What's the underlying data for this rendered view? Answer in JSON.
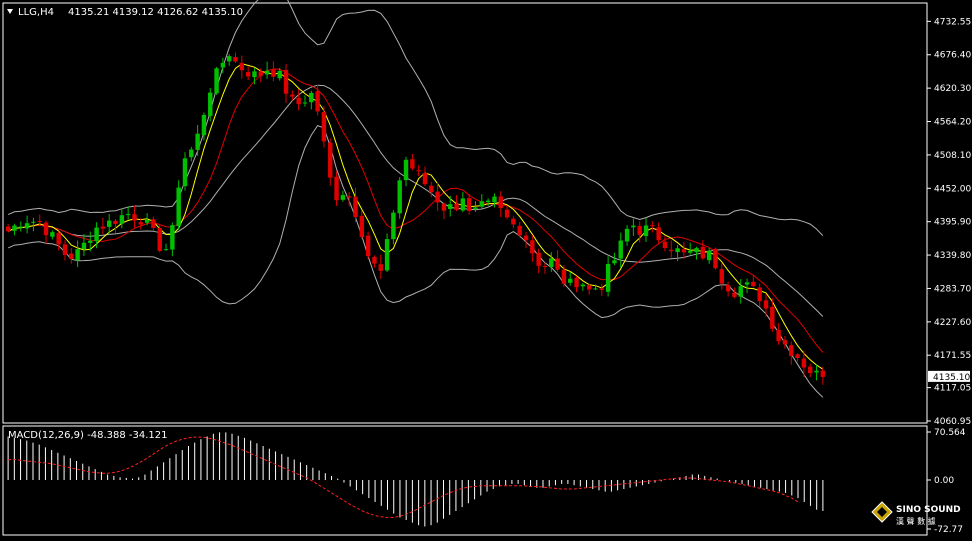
{
  "header": {
    "symbol": "LLG,H4",
    "ohlc": "4135.21 4139.12 4126.62 4135.10"
  },
  "price_axis": {
    "ticks": [
      "4732.55",
      "4676.40",
      "4620.30",
      "4564.20",
      "4508.10",
      "4452.00",
      "4395.90",
      "4339.80",
      "4283.70",
      "4227.60",
      "4171.55",
      "4117.05",
      "4060.95"
    ],
    "current_price_label": "4135.10"
  },
  "macd_panel": {
    "label": "MACD(12,26,9) -48.388 -34.121",
    "ticks": [
      "70.564",
      "0.00",
      "-72.77"
    ]
  },
  "logo": {
    "name": "SINO SOUND",
    "chinese": "漢 聲 數 據"
  },
  "colors": {
    "background": "#000000",
    "bull": "#00c000",
    "bear": "#e00000",
    "bands": "#b0b0b0",
    "ma_fast": "#ffff00",
    "ma_slow": "#e00000",
    "macd_hist": "#ffffff",
    "macd_signal": "#ff2020",
    "grid_border": "#ffffff"
  },
  "chart_data": [
    {
      "type": "candlestick",
      "title": "LLG,H4",
      "ylim": [
        4060.95,
        4760
      ],
      "y_ticks": [
        4732.55,
        4676.4,
        4620.3,
        4564.2,
        4508.1,
        4452.0,
        4395.9,
        4339.8,
        4283.7,
        4227.6,
        4171.55,
        4117.05,
        4060.95
      ],
      "indicators": [
        "bollinger_bands",
        "moving_average_fast",
        "moving_average_slow"
      ],
      "path_points": [
        [
          0,
          4380
        ],
        [
          10,
          4400
        ],
        [
          20,
          4395
        ],
        [
          28,
          4370
        ],
        [
          38,
          4335
        ],
        [
          45,
          4345
        ],
        [
          55,
          4385
        ],
        [
          65,
          4395
        ],
        [
          75,
          4410
        ],
        [
          85,
          4400
        ],
        [
          92,
          4375
        ],
        [
          98,
          4345
        ],
        [
          103,
          4360
        ],
        [
          106,
          4420
        ],
        [
          110,
          4500
        ],
        [
          115,
          4510
        ],
        [
          120,
          4540
        ],
        [
          128,
          4620
        ],
        [
          135,
          4660
        ],
        [
          140,
          4680
        ],
        [
          145,
          4660
        ],
        [
          150,
          4650
        ],
        [
          158,
          4640
        ],
        [
          165,
          4655
        ],
        [
          172,
          4640
        ],
        [
          178,
          4605
        ],
        [
          182,
          4590
        ],
        [
          187,
          4600
        ],
        [
          192,
          4610
        ],
        [
          198,
          4570
        ],
        [
          202,
          4480
        ],
        [
          208,
          4440
        ],
        [
          214,
          4450
        ],
        [
          222,
          4400
        ],
        [
          229,
          4330
        ],
        [
          236,
          4310
        ],
        [
          242,
          4380
        ],
        [
          246,
          4450
        ],
        [
          252,
          4500
        ],
        [
          258,
          4480
        ],
        [
          264,
          4460
        ],
        [
          270,
          4440
        ],
        [
          276,
          4420
        ],
        [
          283,
          4420
        ],
        [
          288,
          4440
        ],
        [
          293,
          4400
        ],
        [
          298,
          4420
        ],
        [
          303,
          4420
        ],
        [
          308,
          4430
        ],
        [
          314,
          4405
        ],
        [
          320,
          4390
        ],
        [
          326,
          4380
        ],
        [
          333,
          4340
        ],
        [
          338,
          4320
        ],
        [
          344,
          4330
        ],
        [
          350,
          4300
        ],
        [
          356,
          4290
        ],
        [
          362,
          4300
        ],
        [
          368,
          4280
        ],
        [
          372,
          4285
        ],
        [
          376,
          4290
        ],
        [
          381,
          4320
        ],
        [
          386,
          4340
        ],
        [
          391,
          4380
        ],
        [
          396,
          4390
        ],
        [
          401,
          4380
        ],
        [
          406,
          4385
        ],
        [
          412,
          4370
        ],
        [
          417,
          4360
        ],
        [
          422,
          4350
        ],
        [
          428,
          4340
        ],
        [
          434,
          4345
        ],
        [
          440,
          4340
        ],
        [
          446,
          4340
        ],
        [
          450,
          4310
        ],
        [
          455,
          4290
        ],
        [
          460,
          4280
        ],
        [
          466,
          4290
        ],
        [
          472,
          4280
        ],
        [
          476,
          4270
        ],
        [
          481,
          4245
        ],
        [
          488,
          4200
        ],
        [
          494,
          4185
        ],
        [
          500,
          4170
        ],
        [
          506,
          4150
        ],
        [
          511,
          4140
        ],
        [
          516,
          4135
        ]
      ],
      "current_price": 4135.1
    },
    {
      "type": "bar",
      "title": "MACD(12,26,9) -48.388 -34.121",
      "ylim": [
        -72.77,
        70.564
      ],
      "macd_value": -48.388,
      "signal_value": -34.121,
      "histogram": [
        64,
        62,
        60,
        58,
        55,
        52,
        48,
        44,
        40,
        36,
        32,
        28,
        24,
        20,
        16,
        12,
        8,
        6,
        4,
        3,
        2,
        4,
        8,
        14,
        20,
        26,
        32,
        38,
        44,
        50,
        55,
        60,
        64,
        68,
        70,
        70,
        68,
        65,
        62,
        58,
        54,
        50,
        46,
        42,
        38,
        34,
        30,
        26,
        22,
        18,
        14,
        10,
        6,
        2,
        -4,
        -10,
        -16,
        -22,
        -28,
        -34,
        -40,
        -46,
        -52,
        -58,
        -62,
        -66,
        -70,
        -72,
        -70,
        -66,
        -60,
        -54,
        -48,
        -42,
        -36,
        -30,
        -24,
        -18,
        -14,
        -10,
        -8,
        -6,
        -6,
        -8,
        -10,
        -12,
        -12,
        -10,
        -8,
        -6,
        -6,
        -8,
        -10,
        -12,
        -14,
        -16,
        -18,
        -18,
        -16,
        -14,
        -12,
        -10,
        -8,
        -6,
        -4,
        -2,
        0,
        2,
        4,
        6,
        8,
        8,
        6,
        4,
        2,
        0,
        -2,
        -4,
        -6,
        -8,
        -10,
        -12,
        -14,
        -16,
        -18,
        -20,
        -24,
        -28,
        -34,
        -40,
        -46,
        -48
      ],
      "signal": [
        30,
        30,
        29,
        28,
        27,
        26,
        25,
        24,
        22,
        20,
        18,
        16,
        14,
        12,
        11,
        10,
        10,
        11,
        13,
        16,
        20,
        25,
        30,
        36,
        42,
        48,
        53,
        57,
        60,
        62,
        63,
        63,
        62,
        60,
        57,
        54,
        51,
        47,
        43,
        39,
        35,
        31,
        27,
        23,
        19,
        15,
        11,
        7,
        3,
        -2,
        -8,
        -14,
        -20,
        -26,
        -32,
        -38,
        -43,
        -48,
        -52,
        -55,
        -57,
        -58,
        -58,
        -56,
        -53,
        -49,
        -44,
        -39,
        -34,
        -29,
        -24,
        -20,
        -16,
        -13,
        -11,
        -10,
        -9,
        -9,
        -9,
        -9,
        -9,
        -9,
        -9,
        -9,
        -10,
        -10,
        -11,
        -12,
        -13,
        -14,
        -14,
        -14,
        -13,
        -12,
        -11,
        -10,
        -9,
        -8,
        -7,
        -6,
        -5,
        -4,
        -3,
        -2,
        -1,
        0,
        1,
        2,
        3,
        3,
        3,
        2,
        1,
        0,
        -1,
        -2,
        -3,
        -5,
        -7,
        -9,
        -11,
        -13,
        -15,
        -17,
        -20,
        -24,
        -28,
        -34
      ]
    }
  ]
}
